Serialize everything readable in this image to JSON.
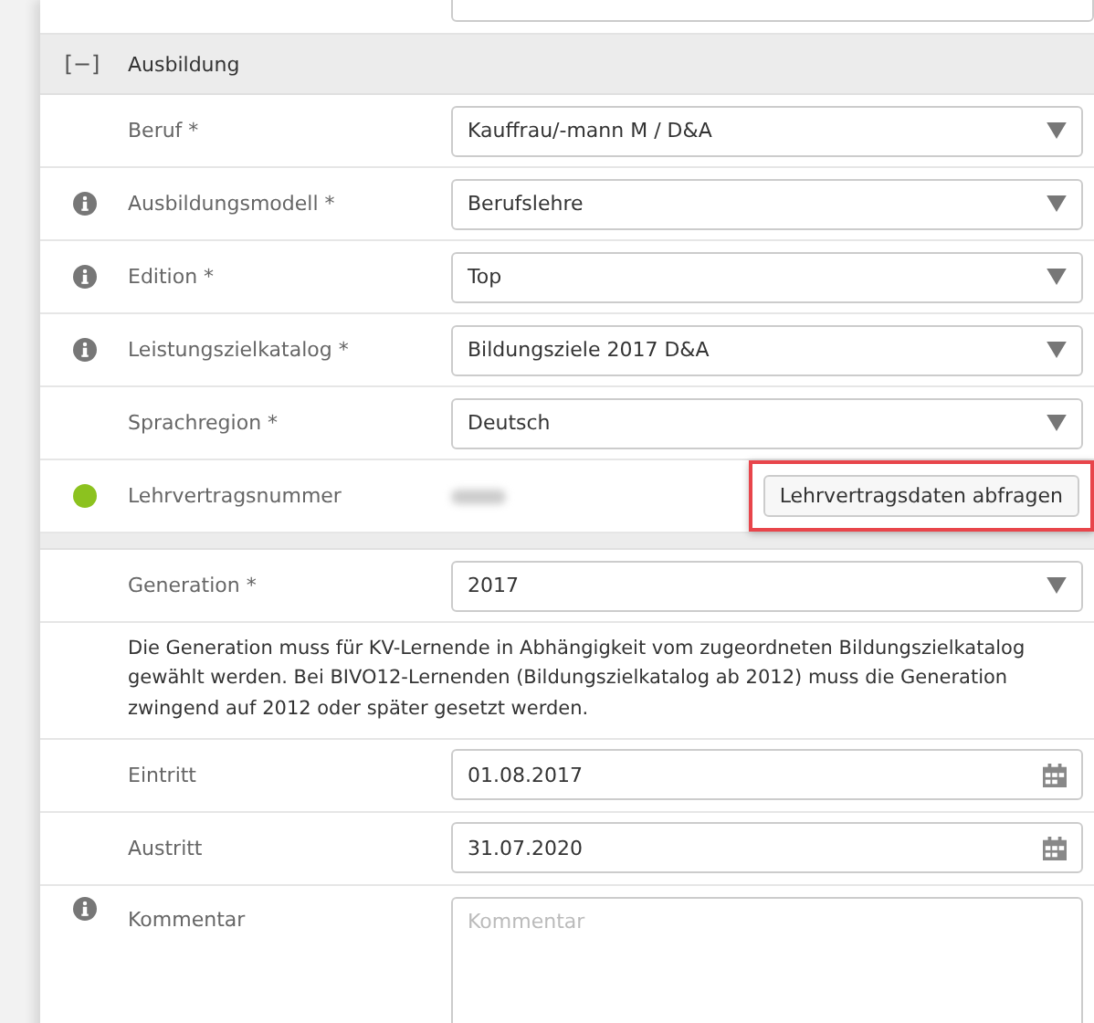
{
  "section": {
    "title": "Ausbildung",
    "toggle": "[−]",
    "expanded": true
  },
  "rows": [
    {
      "kind": "select",
      "label": "Beruf *",
      "info": false,
      "value": "Kauffrau/-mann M / D&A"
    },
    {
      "kind": "select",
      "label": "Ausbildungsmodell *",
      "info": true,
      "value": "Berufslehre"
    },
    {
      "kind": "select",
      "label": "Edition *",
      "info": true,
      "value": "Top"
    },
    {
      "kind": "select",
      "label": "Leistungszielkatalog *",
      "info": true,
      "value": "Bildungsziele 2017 D&A"
    },
    {
      "kind": "select",
      "label": "Sprachregion *",
      "info": false,
      "value": "Deutsch"
    },
    {
      "kind": "action",
      "label": "Lehrvertragsnummer",
      "info": false,
      "color": "#8cc21f",
      "redacted": true,
      "button": "Lehrvertragsdaten abfragen",
      "highlighted": true
    },
    {
      "kind": "gap"
    },
    {
      "kind": "select",
      "label": "Generation *",
      "info": false,
      "value": "2017"
    },
    {
      "kind": "note",
      "text": "Die Generation muss für KV-Lernende in Abhängigkeit vom zugeordneten Bildungszielkatalog gewählt werden. Bei BIVO12-Lernenden (Bildungszielkatalog ab 2012) muss die Generation zwingend auf 2012 oder später gesetzt werden."
    },
    {
      "kind": "date",
      "label": "Eintritt",
      "info": false,
      "value": "01.08.2017"
    },
    {
      "kind": "date",
      "label": "Austritt",
      "info": false,
      "value": "31.07.2020"
    },
    {
      "kind": "textarea",
      "label": "Kommentar",
      "info": true,
      "placeholder": "Kommentar"
    }
  ]
}
